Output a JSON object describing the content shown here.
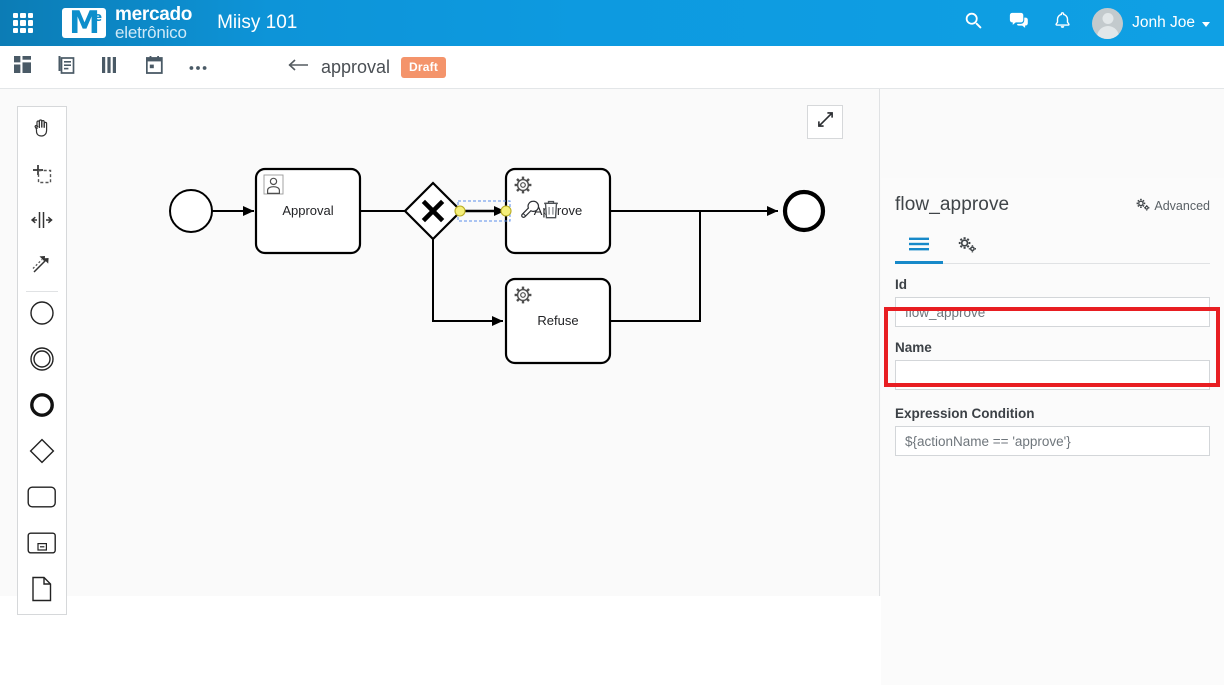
{
  "colors": {
    "header_blue_left": "#0c7cb5",
    "header_blue_right": "#0fa0e4",
    "accent_blue": "#1789c9",
    "draft_orange": "#f4946b",
    "annotation_red": "#e81e22",
    "canvas_bg": "#fafafa"
  },
  "topbar": {
    "apps_icon": "apps-grid-icon",
    "logo": {
      "mark_letter": "M",
      "mark_superscript": "e",
      "line1": "mercado",
      "line2": "eletrônico"
    },
    "app_title": "Miisy 101",
    "icons": [
      {
        "name": "search-icon",
        "label": "Search"
      },
      {
        "name": "chat-icon",
        "label": "Messages"
      },
      {
        "name": "bell-icon",
        "label": "Notifications"
      }
    ],
    "user": {
      "name": "Jonh Joe",
      "avatar": "avatar",
      "caret": "chevron-down-icon"
    }
  },
  "subbar": {
    "tools": [
      {
        "name": "dashboard-icon",
        "label": "Dashboard"
      },
      {
        "name": "form-icon",
        "label": "Forms"
      },
      {
        "name": "columns-icon",
        "label": "Columns"
      },
      {
        "name": "calendar-icon",
        "label": "Calendar"
      },
      {
        "name": "more-icon",
        "label": "More"
      }
    ],
    "back_icon": "arrow-left-icon",
    "doc_name": "approval",
    "status_badge": "Draft"
  },
  "palette": {
    "items": [
      {
        "name": "hand-tool-icon",
        "label": "Activate the hand tool"
      },
      {
        "name": "lasso-tool-icon",
        "label": "Activate the lasso tool"
      },
      {
        "name": "space-tool-icon",
        "label": "Activate the create/remove space tool"
      },
      {
        "name": "global-connect-tool-icon",
        "label": "Activate the global connect tool"
      },
      {
        "name": "start-event-icon",
        "label": "Create StartEvent"
      },
      {
        "name": "intermediate-event-icon",
        "label": "Create Intermediate/Boundary Event"
      },
      {
        "name": "end-event-icon",
        "label": "Create EndEvent"
      },
      {
        "name": "gateway-icon",
        "label": "Create Gateway"
      },
      {
        "name": "task-icon",
        "label": "Create Task"
      },
      {
        "name": "subprocess-icon",
        "label": "Create expanded SubProcess"
      },
      {
        "name": "data-object-icon",
        "label": "Create DataObjectReference"
      }
    ]
  },
  "canvas": {
    "fullscreen_icon": "expand-diagonal-icon",
    "nodes": [
      {
        "name": "start-event",
        "type": "start-event",
        "label": ""
      },
      {
        "name": "task-approval",
        "type": "user-task",
        "label": "Approval",
        "marker": "user-icon"
      },
      {
        "name": "gateway-exclusive",
        "type": "exclusive-gateway",
        "label": "",
        "glyph": "X"
      },
      {
        "name": "task-approve",
        "type": "service-task",
        "label": "Approve",
        "marker": "gears-icon"
      },
      {
        "name": "task-refuse",
        "type": "service-task",
        "label": "Refuse",
        "marker": "gears-icon"
      },
      {
        "name": "end-event",
        "type": "end-event",
        "label": ""
      }
    ],
    "selected_flow": {
      "name": "flow_approve",
      "selected": true,
      "context_pad": [
        {
          "name": "wrench-icon",
          "label": "Change type"
        },
        {
          "name": "trash-icon",
          "label": "Remove"
        }
      ]
    }
  },
  "properties": {
    "title": "flow_approve",
    "advanced": {
      "label": "Advanced",
      "icon": "gears-icon"
    },
    "tabs": [
      {
        "name": "tab-general",
        "icon": "hamburger-icon",
        "active": true
      },
      {
        "name": "tab-settings",
        "icon": "gears-icon",
        "active": false
      }
    ],
    "fields": [
      {
        "name": "id-field",
        "label": "Id",
        "value": "flow_approve",
        "placeholder": ""
      },
      {
        "name": "name-field",
        "label": "Name",
        "value": "",
        "placeholder": ""
      },
      {
        "name": "expression-condition-field",
        "label": "Expression Condition",
        "value": "${actionName == 'approve'}",
        "placeholder": "",
        "highlighted": true
      }
    ]
  }
}
